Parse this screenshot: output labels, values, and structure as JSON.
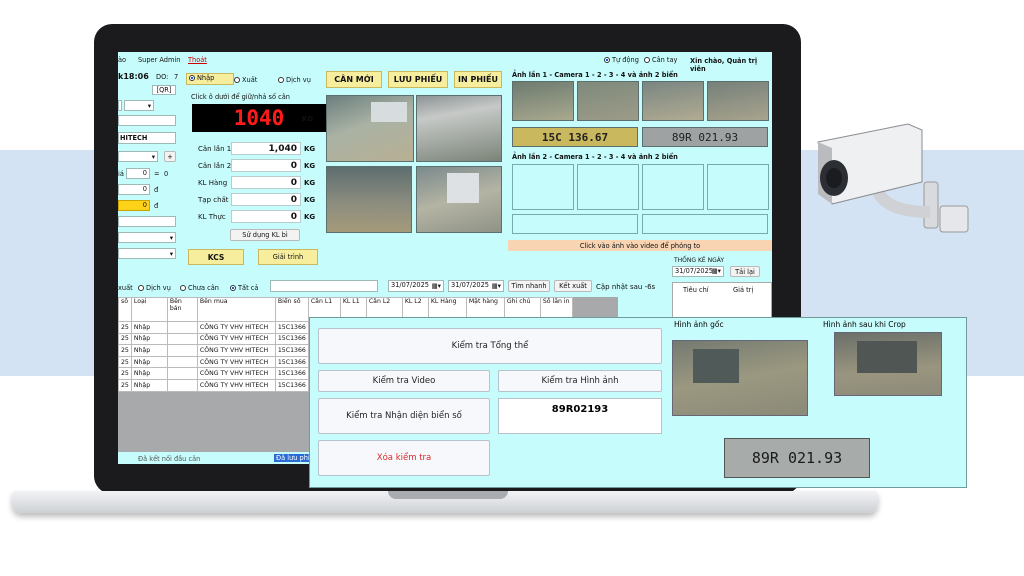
{
  "menu": {
    "left_cut": "ào",
    "admin": "Super Admin",
    "exit": "Thoát",
    "mode_auto": "Tự động",
    "mode_manual": "Cân tay",
    "greeting": "Xin chào, Quản trị viên"
  },
  "left_panel": {
    "time": "k18:06",
    "do_label": "DO:",
    "do_value": "7",
    "qr": "[QR]",
    "company": "HITECH",
    "plus": "+",
    "ia": "iá",
    "zero1": "0",
    "eq": "=",
    "zero2": "0",
    "zero3": "0",
    "d1": "đ",
    "zero4": "0",
    "d2": "đ"
  },
  "weigh": {
    "radio_in": "Nhập",
    "radio_out": "Xuất",
    "radio_service": "Dịch vụ",
    "hint": "Click ô dưới để giữ/nhả số cân",
    "display_value": "1040",
    "unit": "KG",
    "rows": [
      {
        "label": "Cân lần 1",
        "value": "1,040",
        "unit": "KG"
      },
      {
        "label": "Cân lần 2",
        "value": "0",
        "unit": "KG"
      },
      {
        "label": "KL Hàng",
        "value": "0",
        "unit": "KG"
      },
      {
        "label": "Tạp chất",
        "value": "0",
        "unit": "KG"
      },
      {
        "label": "KL Thực",
        "value": "0",
        "unit": "KG"
      }
    ],
    "use_kl": "Sử dụng KL bì",
    "kcs": "KCS",
    "explain": "Giải trình"
  },
  "actions": {
    "weigh_new": "CÂN MỚI",
    "save": "LƯU PHIẾU",
    "print": "IN PHIẾU"
  },
  "images": {
    "title1": "Ảnh lần 1 - Camera 1 - 2 - 3 - 4 và ảnh 2 biển",
    "plate_front": "15C 136.67",
    "plate_rear": "89R 021.93",
    "title2": "Ảnh lần 2 - Camera 1 - 2 - 3 - 4 và ảnh 2 biển",
    "hint": "Click vào ảnh vào video để phóng to"
  },
  "filter": {
    "xuat": "xuất",
    "service": "Dịch vụ",
    "not_weighed": "Chưa cân",
    "all": "Tất cả",
    "date_from": "31/07/2025",
    "date_to": "31/07/2025",
    "quick_search": "Tìm nhanh",
    "export": "Kết xuất",
    "update": "Cập nhật sau -6s"
  },
  "stats": {
    "title": "THỐNG KÊ NGÀY",
    "date": "31/07/2025",
    "reload": "Tải lại",
    "col1": "Tiêu chí",
    "col2": "Giá trị"
  },
  "table": {
    "headers": [
      "số",
      "Loại",
      "Bên bán",
      "Bên mua",
      "Biển số",
      "Cân L1",
      "KL L1",
      "Cân L2",
      "KL L2",
      "KL Hàng",
      "Mặt hàng",
      "Ghi chú",
      "Số lần in"
    ],
    "rows": [
      [
        "25",
        "Nhập",
        "",
        "CÔNG TY VHV HITECH",
        "15C1366"
      ],
      [
        "25",
        "Nhập",
        "",
        "CÔNG TY VHV HITECH",
        "15C1366"
      ],
      [
        "25",
        "Nhập",
        "",
        "CÔNG TY VHV HITECH",
        "15C1366"
      ],
      [
        "25",
        "Nhập",
        "",
        "CÔNG TY VHV HITECH",
        "15C1366"
      ],
      [
        "25",
        "Nhập",
        "",
        "CÔNG TY VHV HITECH",
        "15C1366"
      ],
      [
        "25",
        "Nhập",
        "",
        "CÔNG TY VHV HITECH",
        "15C1366"
      ]
    ]
  },
  "status": {
    "connected": "Đã kết nối đầu cân",
    "recovered": "Đã lưu phiế"
  },
  "check": {
    "overall": "Kiểm tra Tổng thể",
    "video": "Kiểm tra Video",
    "image": "Kiểm tra Hình ảnh",
    "plate": "Kiểm tra Nhận diện biển số",
    "plate_result": "89R02193",
    "clear": "Xóa kiểm tra",
    "orig_title": "Hình ảnh gốc",
    "crop_title": "Hình ảnh sau khi Crop",
    "crop_plate": "89R 021.93",
    "clear_color": "#d92b2b"
  },
  "colors": {
    "screen_bg": "#c7fcfc",
    "display_red": "#ff1a1a",
    "yellow_btn": "#f7ee9d",
    "band": "#d3e3f4"
  }
}
